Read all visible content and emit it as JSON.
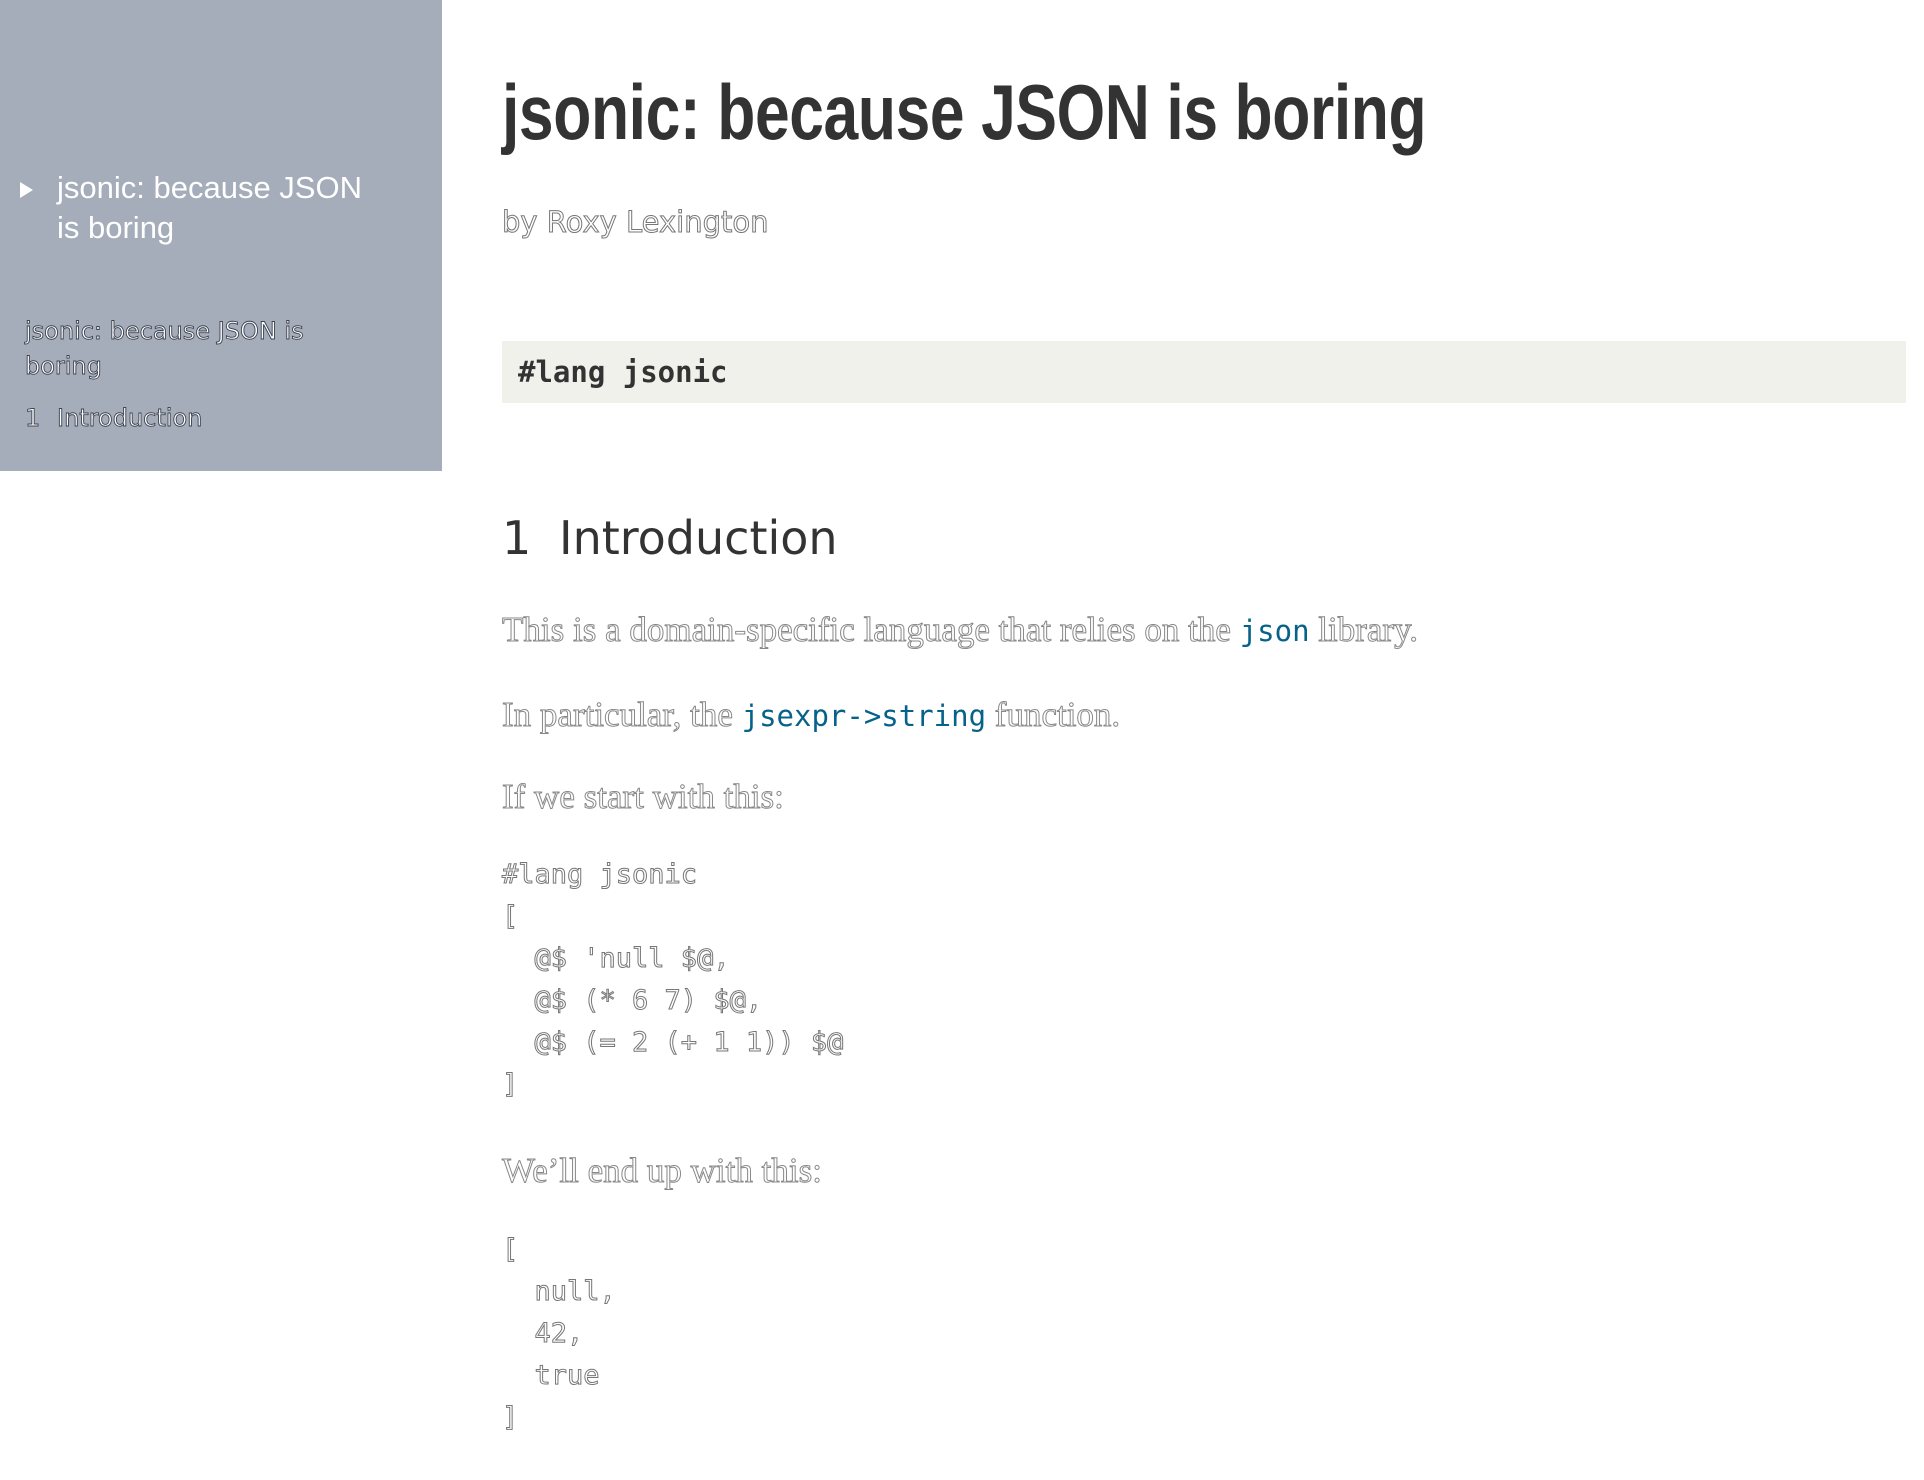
{
  "sidebar": {
    "top_title": "jsonic: because JSON is boring",
    "toc": {
      "title_link": "jsonic: because JSON is boring",
      "items": [
        {
          "number": "1",
          "label": "Introduction"
        }
      ]
    }
  },
  "main": {
    "title": "jsonic: because JSON is boring",
    "author": "by Roxy Lexington",
    "lang_line": "#lang jsonic",
    "section": {
      "number": "1",
      "title": "Introduction"
    },
    "para1": {
      "before": "This is a domain-specific language that relies on the ",
      "link": "json",
      "after": " library."
    },
    "para2": {
      "before": "In particular, the ",
      "link": "jsexpr->string",
      "after": " function."
    },
    "para3": "If we start with this:",
    "code1": [
      "#lang jsonic",
      "[",
      "  @$ 'null $@,",
      "  @$ (* 6 7) $@,",
      "  @$ (= 2 (+ 1 1)) $@",
      "]"
    ],
    "para4": "We’ll end up with this:",
    "code2": [
      "[",
      "  null,",
      "  42,",
      "  true",
      "]"
    ]
  },
  "colors": {
    "sidebar_bg": "#a5adba",
    "lang_box_bg": "#f1f1ec",
    "link": "#07628a",
    "heading": "#333333"
  }
}
